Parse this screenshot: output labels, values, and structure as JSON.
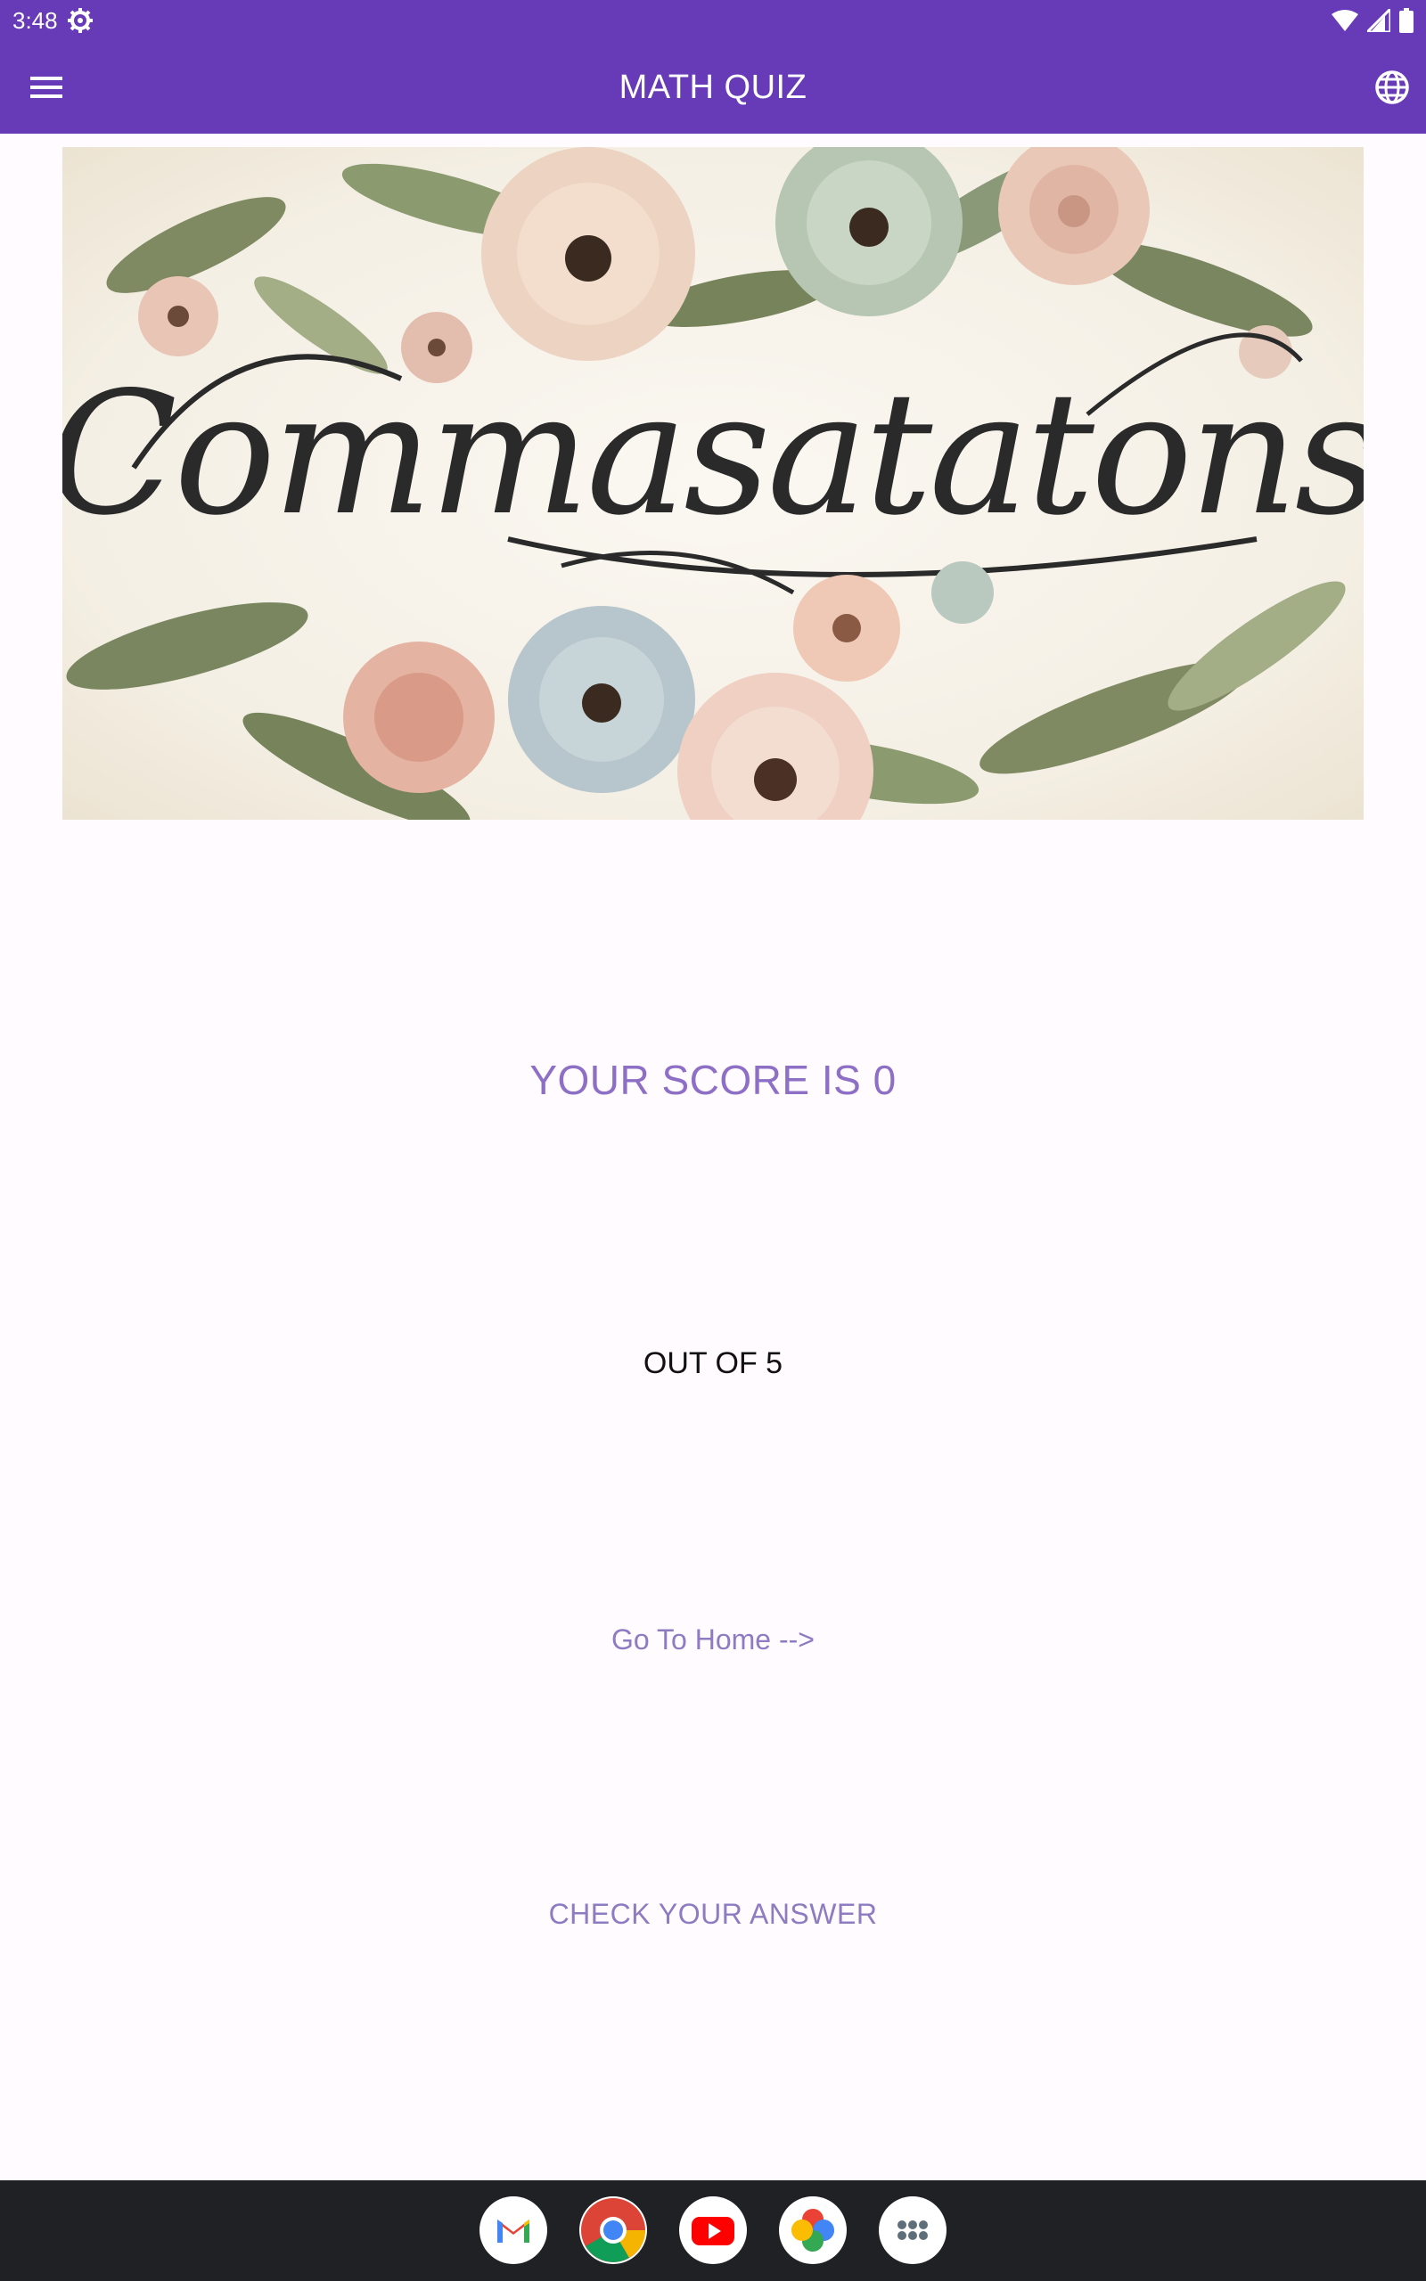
{
  "status_bar": {
    "time": "3:48",
    "icons": [
      "settings-gear-icon",
      "wifi-icon",
      "cell-signal-icon",
      "battery-icon"
    ]
  },
  "app_bar": {
    "title": "MATH QUIZ",
    "menu_icon": "hamburger-menu-icon",
    "language_icon": "globe-icon",
    "color": "#673ab7"
  },
  "banner": {
    "text": "Commasatatons",
    "image": "floral-congratulations-banner"
  },
  "result": {
    "score_text": "YOUR SCORE IS 0",
    "out_of_text": "OUT OF 5",
    "accent_color": "#8e6fc6"
  },
  "actions": {
    "home_link": "Go To Home -->",
    "check_answer": "CHECK YOUR ANSWER"
  },
  "dock": {
    "apps": [
      "gmail-icon",
      "chrome-icon",
      "youtube-icon",
      "photos-icon",
      "app-drawer-icon"
    ]
  }
}
